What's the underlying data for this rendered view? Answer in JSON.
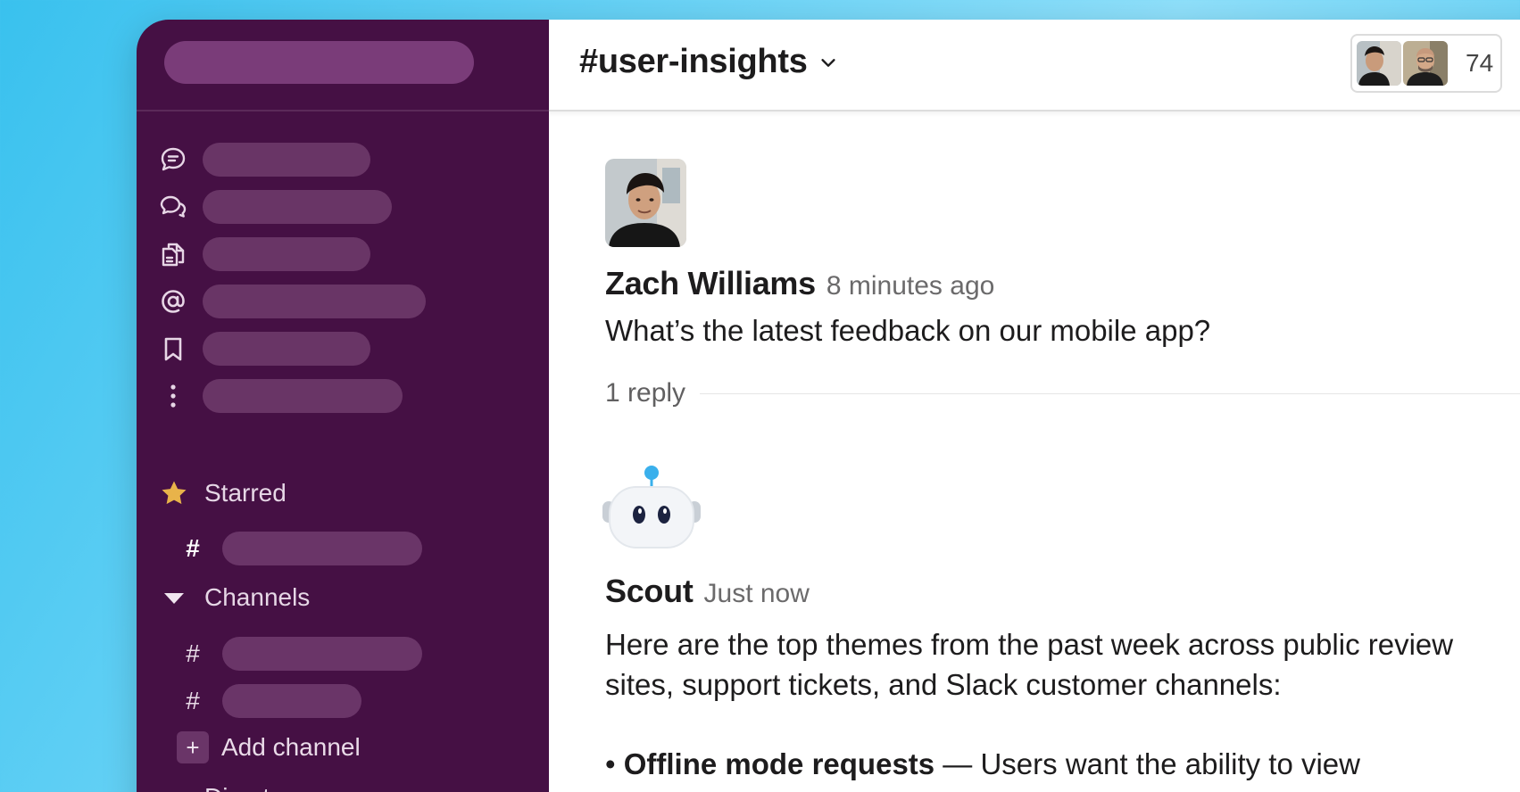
{
  "channel": {
    "name": "#user-insights",
    "member_count": "74"
  },
  "sidebar": {
    "nav_icons": [
      "threads-icon",
      "huddles-icon",
      "drafts-icon",
      "mentions-icon",
      "saved-icon",
      "more-icon"
    ],
    "starred_label": "Starred",
    "channels_label": "Channels",
    "add_channel_label": "Add channel",
    "dm_label": "Direct messages",
    "hash": "#",
    "plus": "+"
  },
  "messages": [
    {
      "author": "Zach Williams",
      "time": "8 minutes ago",
      "text": "What’s the latest feedback on our mobile app?",
      "replies": "1 reply"
    },
    {
      "author": "Scout",
      "time": "Just now",
      "text": "Here are the top themes from the past week across public review sites, support tickets, and Slack customer channels:",
      "bullet_title": "Offline mode requests",
      "bullet_text": " — Users want the ability to view previous conversations without a connection, while traveling."
    }
  ],
  "colors": {
    "sidebar": "#451044",
    "accent_blue": "#39c1ee"
  }
}
